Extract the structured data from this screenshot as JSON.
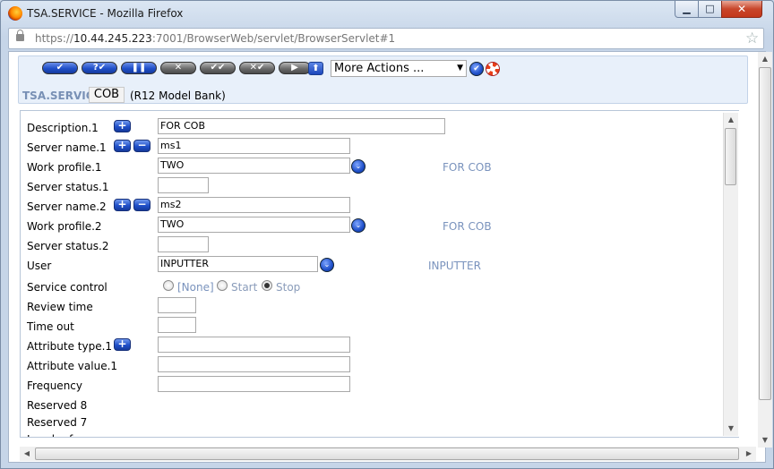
{
  "window": {
    "title": "TSA.SERVICE - Mozilla Firefox",
    "minimize": "▁",
    "maximize": "□",
    "close": "✕"
  },
  "urlbar": {
    "prefix": "https://",
    "host": "10.44.245.223",
    "path": ":7001/BrowserWeb/servlet/BrowserServlet#1",
    "bookmark_icon": "star-icon"
  },
  "toolbar": {
    "buttons": [
      {
        "name": "commit-button",
        "label": "✔",
        "color": "blue"
      },
      {
        "name": "validate-button",
        "label": "?✔",
        "color": "blue"
      },
      {
        "name": "hold-button",
        "label": "❚❚",
        "color": "blue"
      },
      {
        "name": "delete-button",
        "label": "✕",
        "color": "gray"
      },
      {
        "name": "authorise-button",
        "label": "✔✔",
        "color": "gray"
      },
      {
        "name": "reverse-button",
        "label": "✕✔",
        "color": "gray"
      },
      {
        "name": "next-button",
        "label": "▶",
        "color": "gray"
      }
    ],
    "up_label": "⬆",
    "more_actions": "More Actions ...",
    "go_label": "✔"
  },
  "record": {
    "application": "TSA.SERVICE",
    "id": "COB",
    "company": "(R12 Model Bank)"
  },
  "form": {
    "fields": [
      {
        "label": "Description.1",
        "value": "FOR COB"
      },
      {
        "label": "Server name.1",
        "value": "ms1"
      },
      {
        "label": "Work profile.1",
        "value": "TWO",
        "enrichment": "FOR COB"
      },
      {
        "label": "Server status.1",
        "value": ""
      },
      {
        "label": "Server name.2",
        "value": "ms2"
      },
      {
        "label": "Work profile.2",
        "value": "TWO",
        "enrichment": "FOR COB"
      },
      {
        "label": "Server status.2",
        "value": ""
      },
      {
        "label": "User",
        "value": "INPUTTER",
        "enrichment": "INPUTTER"
      },
      {
        "label": "Service control",
        "options": [
          "[None]",
          "Start",
          "Stop"
        ],
        "selected": "Stop"
      },
      {
        "label": "Review time",
        "value": ""
      },
      {
        "label": "Time out",
        "value": ""
      },
      {
        "label": "Attribute type.1",
        "value": ""
      },
      {
        "label": "Attribute value.1",
        "value": ""
      },
      {
        "label": "Frequency",
        "value": ""
      },
      {
        "label": "Reserved 8"
      },
      {
        "label": "Reserved 7"
      },
      {
        "label": "Local ref"
      }
    ],
    "expand_icon": "+",
    "collapse_icon": "−",
    "dropdown_icon": "⌄"
  }
}
